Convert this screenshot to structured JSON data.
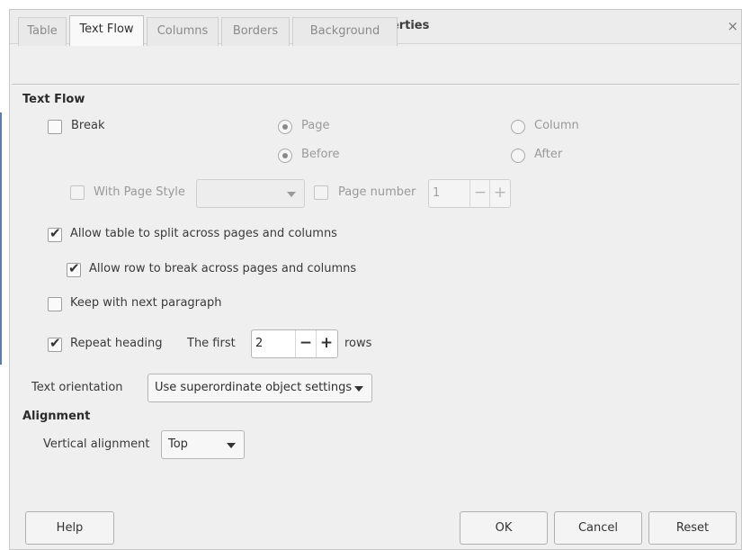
{
  "window": {
    "title": "Table Properties",
    "close_glyph": "×"
  },
  "tabs": [
    {
      "label": "Table",
      "active": false
    },
    {
      "label": "Text Flow",
      "active": true
    },
    {
      "label": "Columns",
      "active": false
    },
    {
      "label": "Borders",
      "active": false
    },
    {
      "label": "Background",
      "active": false
    }
  ],
  "text_flow": {
    "section_title": "Text Flow",
    "break_label": "Break",
    "break_checked": false,
    "radio_page": "Page",
    "radio_column": "Column",
    "radio_before": "Before",
    "radio_after": "After",
    "with_page_style_label": "With Page Style",
    "page_style_value": "",
    "page_number_label": "Page number",
    "page_number_value": "1",
    "allow_split_label": "Allow table to split across pages and columns",
    "allow_split_checked": true,
    "allow_row_break_label": "Allow row to break across pages and columns",
    "allow_row_break_checked": true,
    "keep_with_next_label": "Keep with next paragraph",
    "keep_with_next_checked": false,
    "repeat_heading_label": "Repeat heading",
    "repeat_heading_checked": true,
    "the_first_label": "The first",
    "rows_value": "2",
    "rows_label": "rows",
    "text_orientation_label": "Text orientation",
    "text_orientation_value": "Use superordinate object settings"
  },
  "alignment": {
    "section_title": "Alignment",
    "vertical_label": "Vertical alignment",
    "vertical_value": "Top"
  },
  "buttons": {
    "help": "Help",
    "ok": "OK",
    "cancel": "Cancel",
    "reset": "Reset"
  },
  "spin_glyphs": {
    "minus": "−",
    "plus": "+"
  },
  "check_glyph": "✔",
  "icons": {
    "menu": "chevron-down-icon",
    "close": "close-icon",
    "combo": "chevron-down-icon",
    "check": "checkmark-icon"
  },
  "colors": {
    "dialog_bg": "#efefef",
    "titlebar_bg": "#ececec",
    "disabled_text": "#9a9a9a",
    "left_edge_mark": "#5b7fa8"
  }
}
